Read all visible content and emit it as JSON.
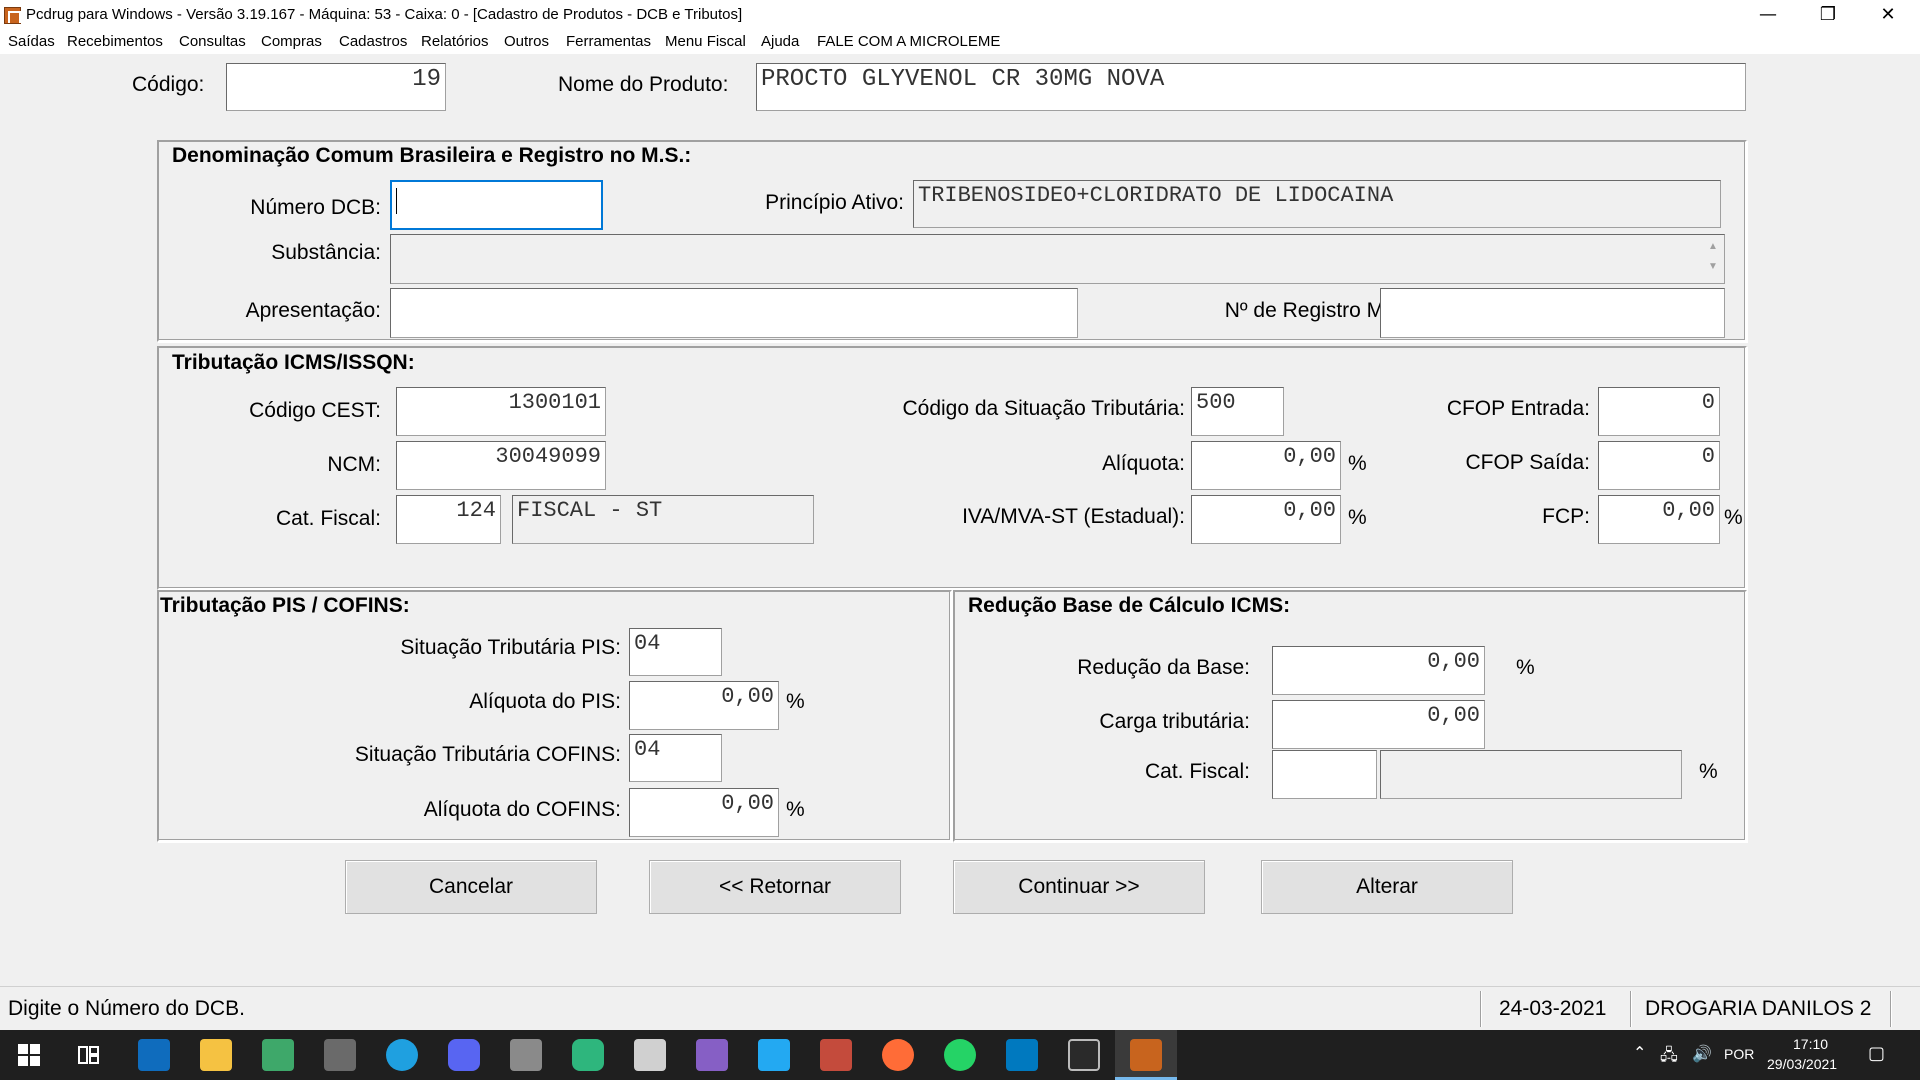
{
  "window": {
    "title": "Pcdrug para Windows - Versão 3.19.167 - Máquina: 53 - Caixa: 0 - [Cadastro de Produtos - DCB e Tributos]",
    "minimize": "—",
    "maximize": "❐",
    "close": "✕"
  },
  "menu": [
    "Saídas",
    "Recebimentos",
    "Consultas",
    "Compras",
    "Cadastros",
    "Relatórios",
    "Outros",
    "Ferramentas",
    "Menu Fiscal",
    "Ajuda",
    "FALE COM A MICROLEME"
  ],
  "header": {
    "codigo_label": "Código:",
    "codigo_value": "19",
    "nome_label": "Nome do Produto:",
    "nome_value": "PROCTO GLYVENOL CR 30MG NOVA"
  },
  "dcb": {
    "title": "Denominação Comum Brasileira e Registro no M.S.:",
    "numero_label": "Número DCB:",
    "numero_value": "",
    "principio_label": "Princípio Ativo:",
    "principio_value": "TRIBENOSIDEO+CLORIDRATO DE LIDOCAINA",
    "substancia_label": "Substância:",
    "substancia_value": "",
    "apresentacao_label": "Apresentação:",
    "apresentacao_value": "",
    "registro_label": "Nº de Registro MS:",
    "registro_value": ""
  },
  "icms": {
    "title": "Tributação ICMS/ISSQN:",
    "cest_label": "Código CEST:",
    "cest_value": "1300101",
    "ncm_label": "NCM:",
    "ncm_value": "30049099",
    "catfiscal_label": "Cat. Fiscal:",
    "catfiscal_code": "124",
    "catfiscal_desc": "FISCAL - ST",
    "cst_label": "Código da Situação Tributária:",
    "cst_value": "500",
    "aliquota_label": "Alíquota:",
    "aliquota_value": "0,00",
    "iva_label": "IVA/MVA-ST (Estadual):",
    "iva_value": "0,00",
    "cfop_entrada_label": "CFOP Entrada:",
    "cfop_entrada_value": "0",
    "cfop_saida_label": "CFOP Saída:",
    "cfop_saida_value": "0",
    "fcp_label": "FCP:",
    "fcp_value": "0,00",
    "percent": "%"
  },
  "pis": {
    "title": "Tributação PIS / COFINS:",
    "st_pis_label": "Situação Tributária PIS:",
    "st_pis_value": "04",
    "aliq_pis_label": "Alíquota do PIS:",
    "aliq_pis_value": "0,00",
    "st_cofins_label": "Situação Tributária COFINS:",
    "st_cofins_value": "04",
    "aliq_cofins_label": "Alíquota do COFINS:",
    "aliq_cofins_value": "0,00",
    "percent": "%"
  },
  "reducao": {
    "title": "Redução Base de Cálculo ICMS:",
    "base_label": "Redução da Base:",
    "base_value": "0,00",
    "carga_label": "Carga tributária:",
    "carga_value": "0,00",
    "catfiscal_label": "Cat. Fiscal:",
    "catfiscal_code": "",
    "catfiscal_desc": "",
    "percent": "%"
  },
  "buttons": {
    "cancelar": "Cancelar",
    "retornar": "<< Retornar",
    "continuar": "Continuar >>",
    "alterar": "Alterar"
  },
  "status": {
    "message": "Digite o Número do DCB.",
    "date": "24-03-2021",
    "store": "DROGARIA DANILOS 2"
  },
  "taskbar": {
    "language": "POR",
    "time": "17:10",
    "date": "29/03/2021",
    "colors": {
      "outlook": "#0f6cbd",
      "explorer": "#f5c242",
      "edge": "#1fa0e0",
      "discord": "#5865f2",
      "vs": "#865fc5",
      "vscode": "#23a9f2",
      "postman": "#ff6c37",
      "whatsapp": "#25d366",
      "trello": "#0079bf",
      "pcdrug": "#c8641e"
    }
  }
}
